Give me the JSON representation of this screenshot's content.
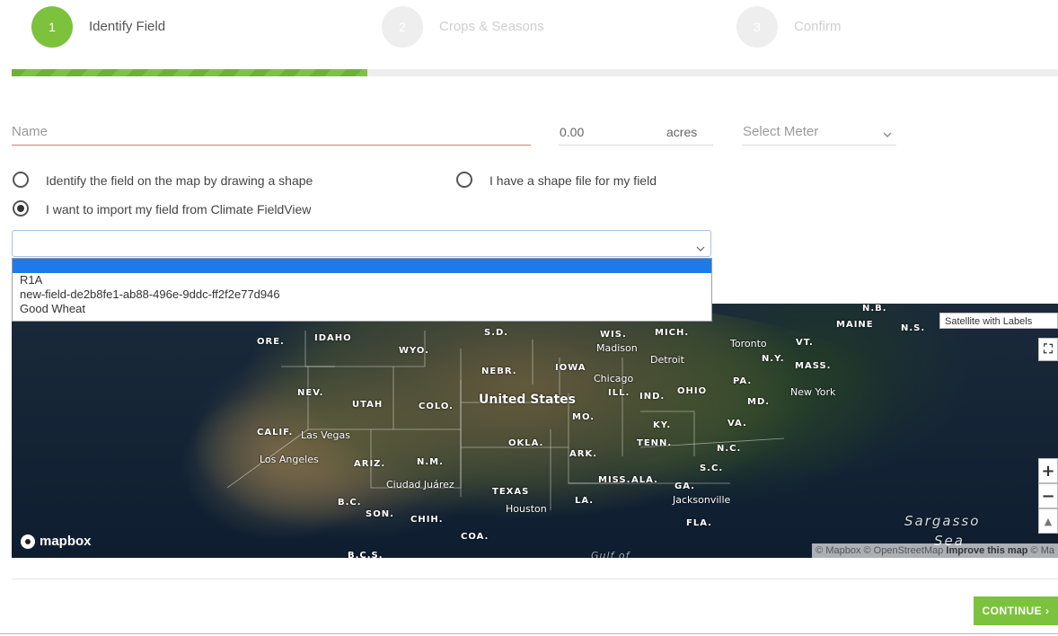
{
  "stepper": {
    "steps": [
      {
        "number": "1",
        "label": "Identify Field"
      },
      {
        "number": "2",
        "label": "Crops & Seasons"
      },
      {
        "number": "3",
        "label": "Confirm"
      }
    ],
    "progress_fraction": 0.34
  },
  "form": {
    "name_placeholder": "Name",
    "acres_value": "0.00",
    "acres_unit": "acres",
    "meter_placeholder": "Select Meter",
    "radio_options": [
      {
        "label": "Identify the field on the map by drawing a shape",
        "checked": false
      },
      {
        "label": "I have a shape file for my field",
        "checked": false
      },
      {
        "label": "I want to import my field from Climate FieldView",
        "checked": true
      }
    ],
    "import_select_value": "",
    "import_options": [
      "",
      "R1A",
      "new-field-de2b8fe1-ab88-496e-9ddc-ff2f2e77d946",
      "Good Wheat"
    ]
  },
  "map": {
    "style_select": "Satellite with Labels",
    "logo_text": "mapbox",
    "attribution": "© Mapbox © OpenStreetMap",
    "improve_link": "Improve this map",
    "attribution_tail": "© Ma",
    "zoom_in": "+",
    "zoom_out": "−",
    "labels": {
      "nb": "N.B.",
      "maine": "MAINE",
      "ns": "N.S.",
      "ore": "ORE.",
      "idaho": "IDAHO",
      "wyo": "WYO.",
      "sd": "S.D.",
      "wis": "WIS.",
      "mich": "MICH.",
      "madison": "Madison",
      "toronto": "Toronto",
      "vt": "VT.",
      "ny": "N.Y.",
      "detroit": "Detroit",
      "nebr": "NEBR.",
      "iowa": "IOWA",
      "chicago": "Chicago",
      "mass": "MASS.",
      "pa": "PA.",
      "nev": "NEV.",
      "ill": "ILL.",
      "ind": "IND.",
      "ohio": "OHIO",
      "newyork": "New York",
      "md": "MD.",
      "utah": "UTAH",
      "colo": "COLO.",
      "us": "United States",
      "mo": "MO.",
      "ky": "KY.",
      "va": "VA.",
      "calif": "CALIF.",
      "lasvegas": "Las Vegas",
      "okla": "OKLA.",
      "tenn": "TENN.",
      "ark": "ARK.",
      "nc": "N.C.",
      "losangeles": "Los Angeles",
      "ariz": "ARIZ.",
      "nm": "N.M.",
      "sc": "S.C.",
      "ciudadjuarez": "Ciudad Juárez",
      "miss": "MISS.",
      "ala": "ALA.",
      "ga": "GA.",
      "texas": "TEXAS",
      "la": "LA.",
      "jacksonville": "Jacksonville",
      "bc": "B.C.",
      "houston": "Houston",
      "son": "SON.",
      "chih": "CHIH.",
      "fla": "FLA.",
      "sargasso": "Sargasso",
      "sea": "Sea",
      "coa": "COA.",
      "bcs": "B.C.S.",
      "gulfof": "Gulf of"
    }
  },
  "footer": {
    "continue_label": "CONTINUE ›"
  }
}
